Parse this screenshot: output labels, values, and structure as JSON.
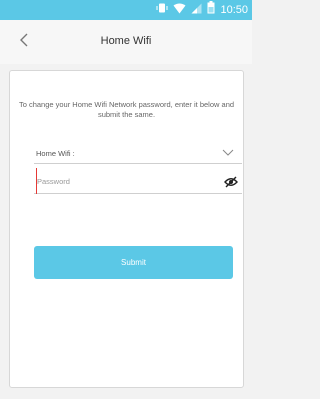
{
  "status_bar": {
    "time": "10:50",
    "icons": [
      "vibrate-icon",
      "wifi-icon",
      "signal-icon",
      "battery-icon"
    ],
    "background": "#5bc8e6"
  },
  "header": {
    "title": "Home Wifi",
    "back_icon": "chevron-left-icon"
  },
  "form": {
    "instruction": "To change your Home Wifi Network password, enter it below and submit the same.",
    "wifi_label": "Home Wifi :",
    "password_placeholder": "Password",
    "password_value": "",
    "submit_label": "Submit",
    "accent": "#5bc8e6"
  }
}
